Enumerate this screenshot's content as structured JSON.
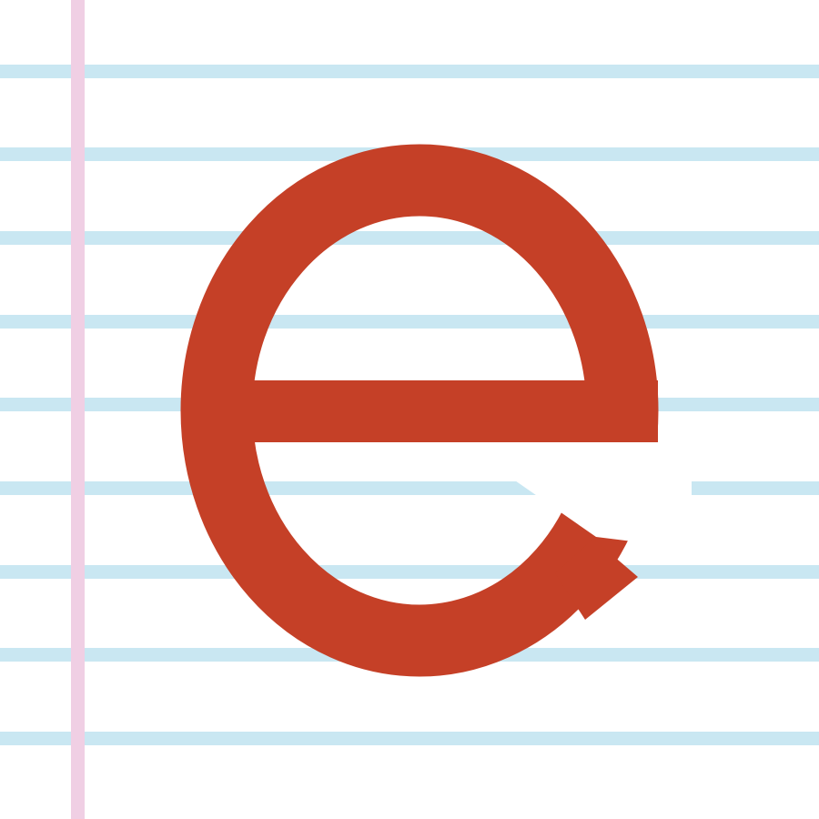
{
  "logo": {
    "letter": "e",
    "letter_color": "#c54027"
  },
  "paper": {
    "background_color": "#ffffff",
    "rule_color": "#c9e7f2",
    "margin_line_color": "#f0cfe4",
    "rule_count": 9
  }
}
